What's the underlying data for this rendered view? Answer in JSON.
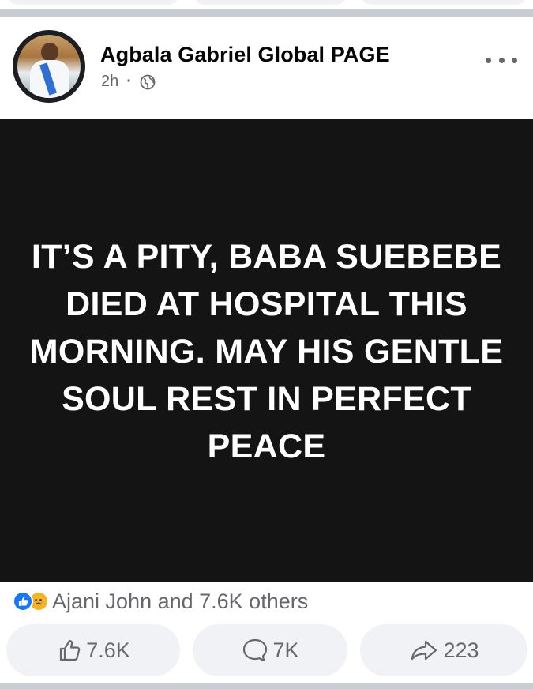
{
  "post": {
    "page_name": "Agbala Gabriel Global PAGE",
    "time": "2h",
    "separator_dot": "·",
    "privacy_icon": "globe-icon",
    "more_icon": "more-options-icon",
    "image_text": "IT’S A PITY, BABA SUEBEBE DIED AT HOSPITAL THIS MORNING. MAY HIS GENTLE SOUL REST IN PERFECT PEACE",
    "image_background": "#141414"
  },
  "reactions": {
    "icons": [
      "like-reaction-icon",
      "sad-reaction-icon"
    ],
    "summary": "Ajani John and 7.6K others"
  },
  "actions": {
    "like_count": "7.6K",
    "comment_count": "7K",
    "share_count": "223"
  },
  "colors": {
    "accent": "#1877f2",
    "secondary_text": "#65676b",
    "button_bg": "#f0f2f5",
    "separator": "#c9ccd1"
  }
}
